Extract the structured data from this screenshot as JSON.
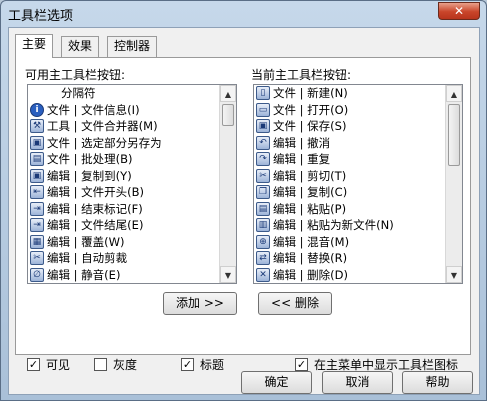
{
  "window": {
    "title": "工具栏选项",
    "close_glyph": "✕"
  },
  "tabs": [
    {
      "label": "主要",
      "active": true
    },
    {
      "label": "效果",
      "active": false
    },
    {
      "label": "控制器",
      "active": false
    }
  ],
  "available": {
    "label": "可用主工具栏按钮:",
    "items": [
      {
        "icon": "none",
        "text": "分隔符"
      },
      {
        "icon": "info-icon",
        "text": "文件 | 文件信息(I)"
      },
      {
        "icon": "tools-icon",
        "text": "工具 | 文件合并器(M)"
      },
      {
        "icon": "save-icon",
        "text": "文件 | 选定部分另存为"
      },
      {
        "icon": "batch-icon",
        "text": "文件 | 批处理(B)"
      },
      {
        "icon": "save-icon",
        "text": "编辑 | 复制到(Y)"
      },
      {
        "icon": "file-start-icon",
        "text": "编辑 | 文件开头(B)"
      },
      {
        "icon": "end-mark-icon",
        "text": "编辑 | 结束标记(F)"
      },
      {
        "icon": "file-end-icon",
        "text": "编辑 | 文件结尾(E)"
      },
      {
        "icon": "overwrite-icon",
        "text": "编辑 | 覆盖(W)"
      },
      {
        "icon": "auto-trim-icon",
        "text": "编辑 | 自动剪裁"
      },
      {
        "icon": "mute-icon",
        "text": "编辑 | 静音(E)"
      }
    ]
  },
  "current": {
    "label": "当前主工具栏按钮:",
    "items": [
      {
        "icon": "new-file-icon",
        "text": "文件 | 新建(N)"
      },
      {
        "icon": "open-folder-icon",
        "text": "文件 | 打开(O)"
      },
      {
        "icon": "save-icon",
        "text": "文件 | 保存(S)"
      },
      {
        "icon": "undo-icon",
        "text": "编辑 | 撤消"
      },
      {
        "icon": "redo-icon",
        "text": "编辑 | 重复"
      },
      {
        "icon": "scissors-icon",
        "text": "编辑 | 剪切(T)"
      },
      {
        "icon": "copy-icon",
        "text": "编辑 | 复制(C)"
      },
      {
        "icon": "paste-icon",
        "text": "编辑 | 粘贴(P)"
      },
      {
        "icon": "paste-new-icon",
        "text": "编辑 | 粘贴为新文件(N)"
      },
      {
        "icon": "mix-icon",
        "text": "编辑 | 混音(M)"
      },
      {
        "icon": "replace-icon",
        "text": "编辑 | 替换(R)"
      },
      {
        "icon": "delete-icon",
        "text": "编辑 | 删除(D)"
      }
    ]
  },
  "buttons": {
    "add": "添加 >>",
    "remove": "<< 删除",
    "ok": "确定",
    "cancel": "取消",
    "help": "帮助"
  },
  "options": {
    "visible": {
      "label": "可见",
      "checked": true
    },
    "gray": {
      "label": "灰度",
      "checked": false
    },
    "caption": {
      "label": "标题",
      "checked": true
    },
    "show_icons": {
      "label": "在主菜单中显示工具栏图标",
      "checked": true
    }
  },
  "check_glyph": "✓"
}
